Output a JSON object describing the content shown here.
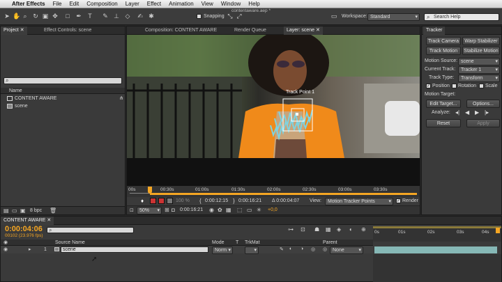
{
  "menubar": {
    "app": "After Effects",
    "items": [
      "File",
      "Edit",
      "Composition",
      "Layer",
      "Effect",
      "Animation",
      "View",
      "Window",
      "Help"
    ]
  },
  "toolbar": {
    "snapping": "Snapping",
    "workspace_label": "Workspace:",
    "workspace_value": "Standard",
    "search_placeholder": "Search Help"
  },
  "window_title": "contentaware.aep *",
  "project": {
    "tabs": [
      "Project",
      "Effect Controls: scene"
    ],
    "column_header": "Name",
    "items": [
      "CONTENT AWARE",
      "scene"
    ],
    "bpc": "8 bpc"
  },
  "viewer": {
    "tabs": [
      "Composition: CONTENT AWARE",
      "Render Queue",
      "Layer: scene"
    ],
    "track_point": "Track Point 1",
    "ruler": [
      "00s",
      "00:30s",
      "01:00s",
      "01:30s",
      "02:00s",
      "02:30s",
      "03:00s",
      "03:30s"
    ],
    "bottom1": {
      "zoom_pct": "100 %",
      "in": "0:00:12:15",
      "out": "0:00:16:21",
      "delta": "Δ 0:00:04:07",
      "view_label": "View:",
      "view_value": "Motion Tracker Points",
      "render": "Render"
    },
    "bottom2": {
      "zoom": "50%",
      "time": "0:00:16:21",
      "exposure": "+0,0"
    }
  },
  "tracker": {
    "title": "Tracker",
    "track_camera": "Track Camera",
    "warp_stabilizer": "Warp Stabilizer",
    "track_motion": "Track Motion",
    "stabilize_motion": "Stabilize Motion",
    "motion_source_label": "Motion Source:",
    "motion_source": "scene",
    "current_track_label": "Current Track:",
    "current_track": "Tracker 1",
    "track_type_label": "Track Type:",
    "track_type": "Transform",
    "position": "Position",
    "rotation": "Rotation",
    "scale": "Scale",
    "motion_target_label": "Motion Target:",
    "edit_target": "Edit Target...",
    "options": "Options...",
    "analyze_label": "Analyze:",
    "reset": "Reset",
    "apply": "Apply"
  },
  "timeline": {
    "tab": "CONTENT AWARE",
    "timecode": "0:00:04:06",
    "frames": "00102 (23.976 fps)",
    "columns": {
      "source": "Source Name",
      "mode": "Mode",
      "t": "T",
      "trkmat": "TrkMat",
      "parent": "Parent"
    },
    "ruler": [
      "0s",
      "01s",
      "02s",
      "03s",
      "04s"
    ],
    "layer": {
      "index": "1",
      "name": "scene",
      "mode": "Norm",
      "parent": "None"
    }
  },
  "colors": {
    "accent_orange": "#f5a623",
    "timeline_bar": "#86b8b6",
    "tracker_path": "#7fd3e0"
  }
}
